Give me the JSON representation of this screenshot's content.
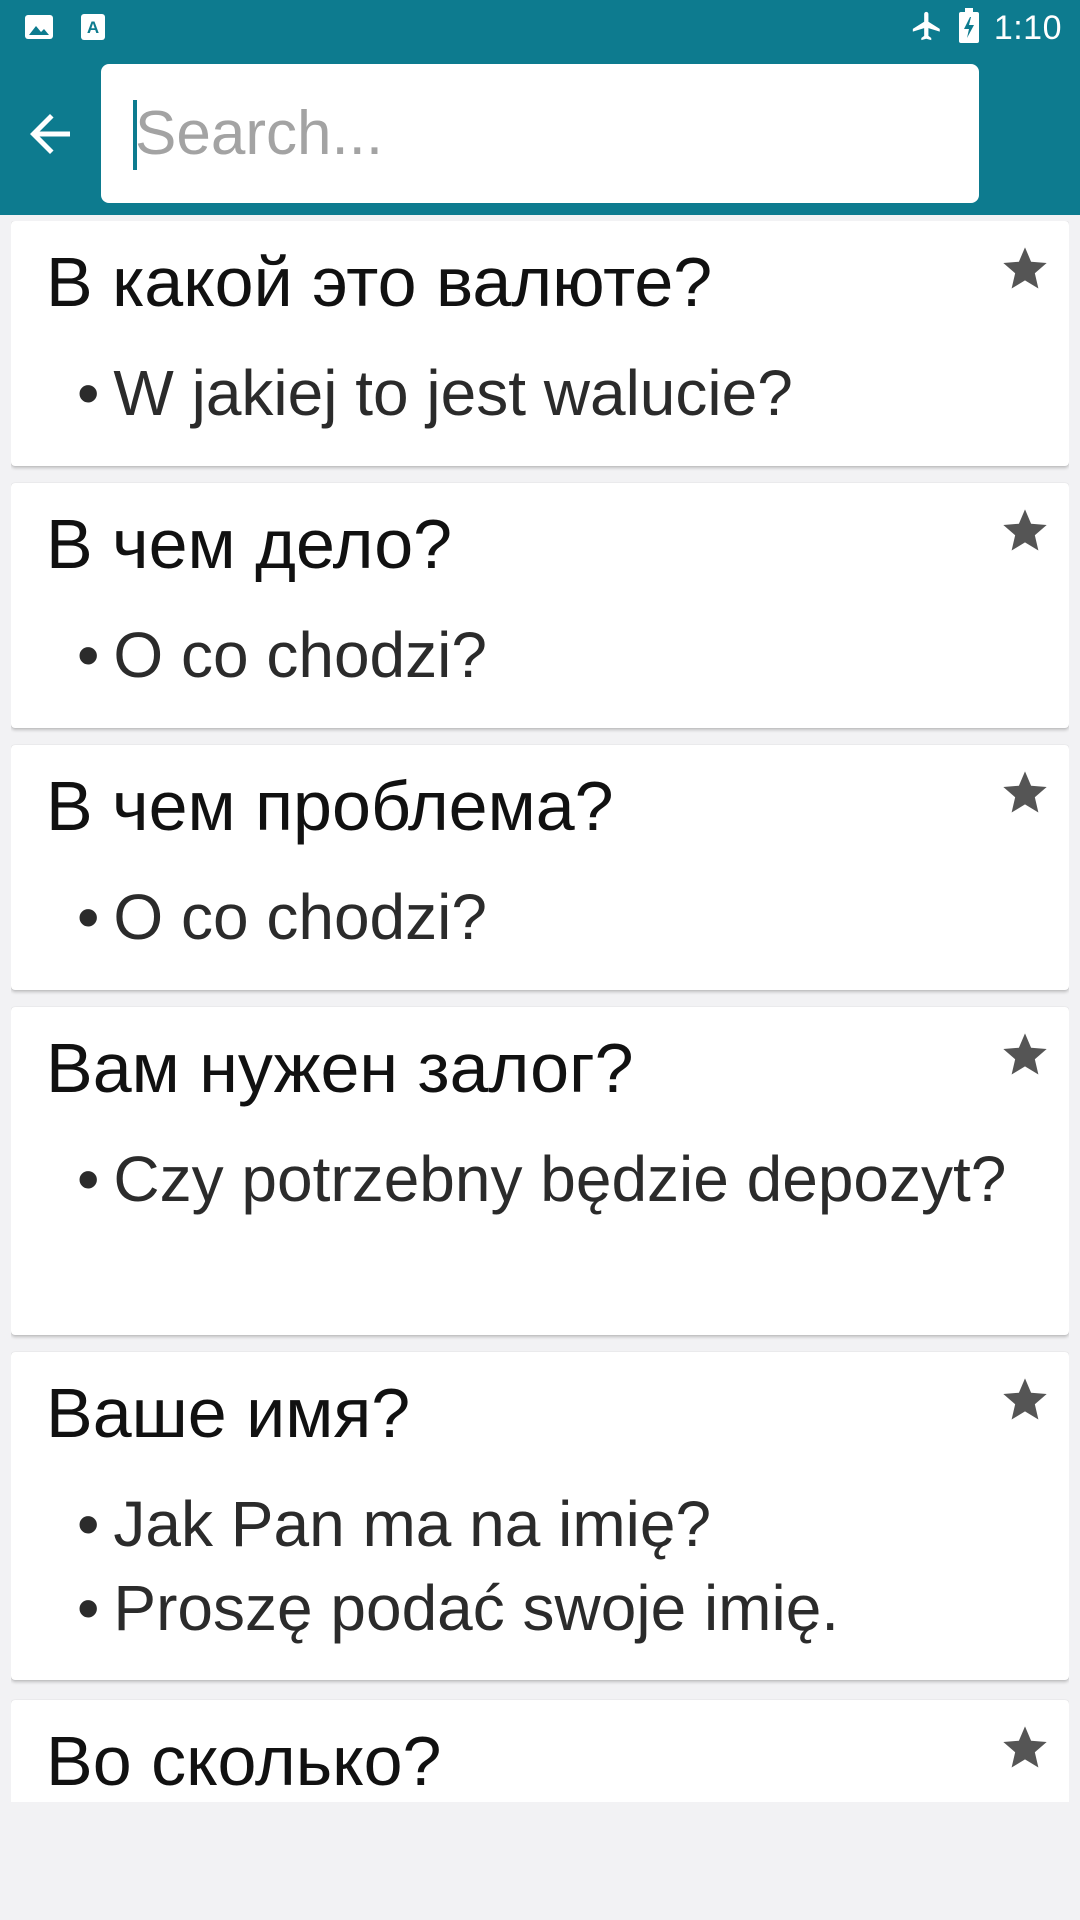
{
  "status_bar": {
    "time": "1:10",
    "icons": [
      "image-icon",
      "translate-app-icon",
      "airplane-mode-icon",
      "battery-charging-icon"
    ]
  },
  "search": {
    "placeholder": "Search...",
    "value": ""
  },
  "phrases": [
    {
      "phrase": "В какой это валюте?",
      "translations": [
        "W jakiej to jest walucie?"
      ]
    },
    {
      "phrase": "В чем дело?",
      "translations": [
        "O co chodzi?"
      ]
    },
    {
      "phrase": "В чем проблема?",
      "translations": [
        "O co chodzi?"
      ]
    },
    {
      "phrase": "Вам нужен залог?",
      "translations": [
        "Czy potrzebny będzie depozyt?"
      ]
    },
    {
      "phrase": "Ваше имя?",
      "translations": [
        "Jak Pan ma na imię?",
        "Proszę podać swoje imię."
      ]
    },
    {
      "phrase": "Во сколько?",
      "translations": []
    }
  ],
  "colors": {
    "app_bar": "#0d7b8f",
    "background": "#f2f2f4",
    "star": "#555555"
  }
}
